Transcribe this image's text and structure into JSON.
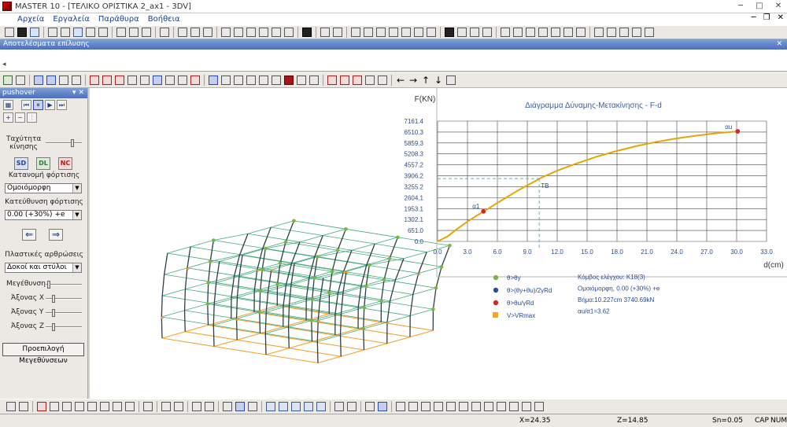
{
  "window": {
    "title": "MASTER 10 - [ΤΕΛΙΚΟ ΟΡΙΣΤΙΚΑ 2_ax1 - 3DV]"
  },
  "menu": [
    "Αρχεία",
    "Εργαλεία",
    "Παράθυρα",
    "Βοήθεια"
  ],
  "results_panel": {
    "title": "Αποτελέσματα επίλυσης"
  },
  "pushover": {
    "title": "pushover",
    "speed_label": "Ταχύτητα κίνησης",
    "mode_buttons": [
      "SD",
      "DL",
      "NC"
    ],
    "load_distribution_label": "Κατανομή φόρτισης",
    "load_distribution_value": "Ομοιόμορφη",
    "load_direction_label": "Κατεύθυνση φόρτισης",
    "load_direction_value": "0.00 (+30%) +e",
    "hinges_label": "Πλαστικές αρθρώσεις",
    "hinges_value": "Δοκοί και στύλοι",
    "magnification_label": "Μεγέθυνση",
    "axis_x_label": "Άξονας X",
    "axis_y_label": "Άξονας Y",
    "axis_z_label": "Άξονας Z",
    "preview_button": "Προεπιλογή Μεγεθύνσεων",
    "levels": {
      "speed": 0.75,
      "magnification": 0.05,
      "axis_x": 0.2,
      "axis_y": 0.2,
      "axis_z": 0.2
    }
  },
  "chart_data": {
    "type": "line",
    "title": "Διάγραμμα Δύναμης-Μετακίνησης - F-d",
    "ylabel": "F(KN)",
    "xlabel": "d(cm)",
    "xlim": [
      0,
      33
    ],
    "ylim": [
      0,
      7161.4
    ],
    "x_ticks": [
      0.0,
      3.0,
      6.0,
      9.0,
      12.0,
      15.0,
      18.0,
      21.0,
      24.0,
      27.0,
      30.0,
      33.0
    ],
    "x_tick_labels": [
      "0.0",
      "3.0",
      "6.0",
      "9.0",
      "12.0",
      "15.0",
      "18.0",
      "21.0",
      "24.0",
      "27.0",
      "30.0",
      "33.0"
    ],
    "y_ticks": [
      0.0,
      651.0,
      1302.1,
      1953.1,
      2604.1,
      3255.2,
      3906.2,
      4557.2,
      5208.3,
      5859.3,
      6510.3,
      7161.4
    ],
    "y_tick_labels": [
      "0.0",
      "651.0",
      "1302.1",
      "1953.1",
      "2604.1",
      "3255.2",
      "3906.2",
      "4557.2",
      "5208.3",
      "5859.3",
      "6510.3",
      "7161.4"
    ],
    "grid": true,
    "series": [
      {
        "color": "#e8a400",
        "x": [
          0,
          1,
          2,
          3,
          4,
          5,
          6,
          7,
          8,
          9,
          10,
          10.2,
          12,
          14,
          16,
          18,
          20,
          22,
          24,
          26,
          28,
          30.1
        ],
        "y": [
          0,
          300,
          760,
          1180,
          1560,
          1920,
          2290,
          2650,
          3010,
          3340,
          3650,
          3740,
          4210,
          4650,
          5050,
          5390,
          5680,
          5930,
          6130,
          6300,
          6440,
          6550
        ]
      }
    ],
    "annotations": [
      {
        "label": "α1",
        "x": 4.6,
        "y": 1790,
        "color": "#d7261f"
      },
      {
        "label": "TB",
        "x": 10.2,
        "y": 3740,
        "color": "#4db6c8"
      },
      {
        "label": "αu",
        "x": 30.1,
        "y": 6550,
        "color": "#d7261f"
      }
    ],
    "legend": [
      {
        "label": "θ>θy",
        "color": "#7cb342",
        "shape": "circle"
      },
      {
        "label": "θ>(θy+θu)/2γRd",
        "color": "#2b4c9b",
        "shape": "circle"
      },
      {
        "label": "θ>θu/γRd",
        "color": "#d7261f",
        "shape": "circle"
      },
      {
        "label": "V>VRmax",
        "color": "#f5a623",
        "shape": "square"
      }
    ],
    "info": [
      "Κόμβος ελέγχου: K18(3)",
      "Ομοιόμορφη, 0.00 (+30%) +e",
      "Βήμα:10.227cm 3740.69kN",
      "αu/α1=3.62"
    ]
  },
  "status": {
    "x": "X=24.35",
    "z": "Z=14.85",
    "sn": "Sn=0.05",
    "caps": "CAP",
    "num": "NUM"
  }
}
